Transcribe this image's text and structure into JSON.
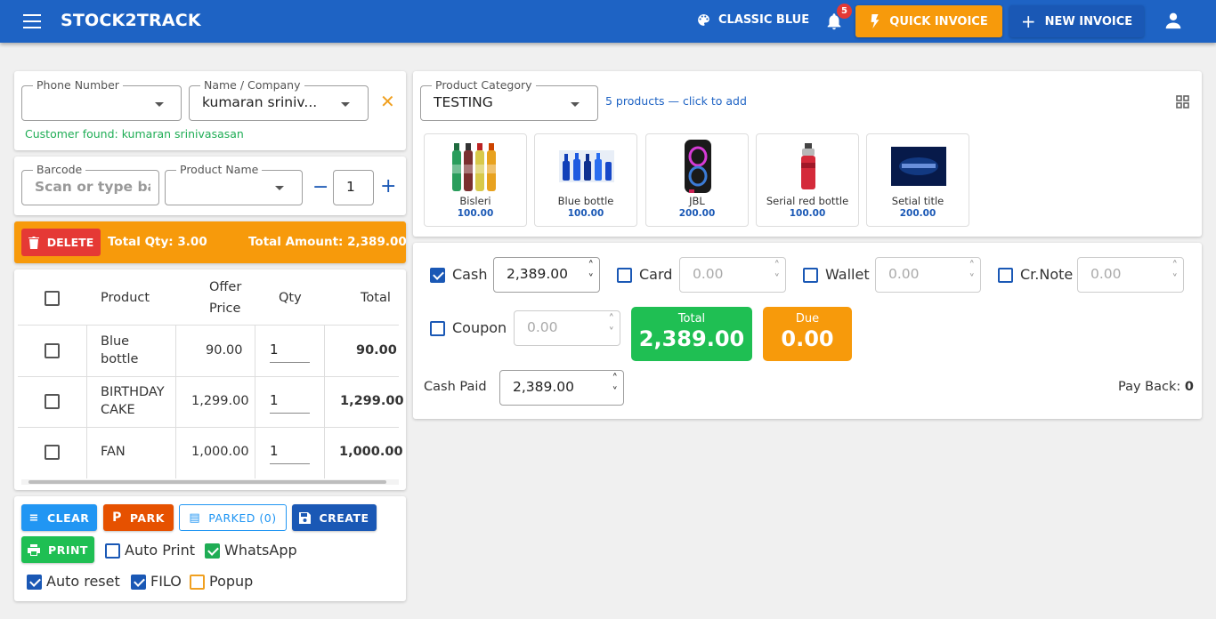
{
  "header": {
    "title": "STOCK2TRACK",
    "theme_label": "CLASSIC BLUE",
    "notification_count": "5",
    "quick_invoice_label": "QUICK INVOICE",
    "new_invoice_label": "NEW INVOICE"
  },
  "customer": {
    "phone_label": "Phone Number",
    "phone_value": "",
    "name_label": "Name / Company",
    "name_value": "kumaran sriniv...",
    "found_text": "Customer found: kumaran srinivasasan"
  },
  "entry": {
    "barcode_label": "Barcode",
    "barcode_placeholder": "Scan or type ba",
    "product_label": "Product Name",
    "qty_value": "1"
  },
  "summary": {
    "delete_label": "DELETE",
    "total_qty": "Total Qty: 3.00",
    "total_amount": "Total Amount: 2,389.00"
  },
  "table": {
    "headers": [
      "Product",
      "Offer",
      "Price",
      "Qty",
      "Total"
    ],
    "rows": [
      {
        "product_line1": "Blue",
        "product_line2": "bottle",
        "price": "90.00",
        "qty": "1",
        "total": "90.00"
      },
      {
        "product_line1": "BIRTHDAY",
        "product_line2": "CAKE",
        "price": "1,299.00",
        "qty": "1",
        "total": "1,299.00"
      },
      {
        "product_line1": "FAN",
        "product_line2": "",
        "price": "1,000.00",
        "qty": "1",
        "total": "1,000.00"
      }
    ]
  },
  "actions": {
    "clear": "CLEAR",
    "park": "PARK",
    "parked": "PARKED (0)",
    "create": "CREATE",
    "print": "PRINT",
    "auto_print": "Auto Print",
    "whatsapp": "WhatsApp",
    "auto_reset": "Auto reset",
    "filo": "FILO",
    "popup": "Popup"
  },
  "catalog": {
    "category_label": "Product Category",
    "category_value": "TESTING",
    "count_text": "5 products — click to add",
    "products": [
      {
        "name": "Bisleri",
        "price": "100.00"
      },
      {
        "name": "Blue bottle",
        "price": "100.00"
      },
      {
        "name": "JBL",
        "price": "200.00"
      },
      {
        "name": "Serial red bottle",
        "price": "100.00"
      },
      {
        "name": "Setial title",
        "price": "200.00"
      }
    ]
  },
  "payment": {
    "cash_label": "Cash",
    "cash_value": "2,389.00",
    "card_label": "Card",
    "card_value": "0.00",
    "wallet_label": "Wallet",
    "wallet_value": "0.00",
    "crnote_label": "Cr.Note",
    "crnote_value": "0.00",
    "coupon_label": "Coupon",
    "coupon_value": "0.00",
    "total_label": "Total",
    "total_value": "2,389.00",
    "due_label": "Due",
    "due_value": "0.00",
    "cash_paid_label": "Cash Paid",
    "cash_paid_value": "2,389.00",
    "payback_label": "Pay Back:",
    "payback_value": "0"
  },
  "colors": {
    "primary": "#1e63c4",
    "accent": "#f79a0b",
    "danger": "#e53935",
    "success": "#1fad55"
  }
}
